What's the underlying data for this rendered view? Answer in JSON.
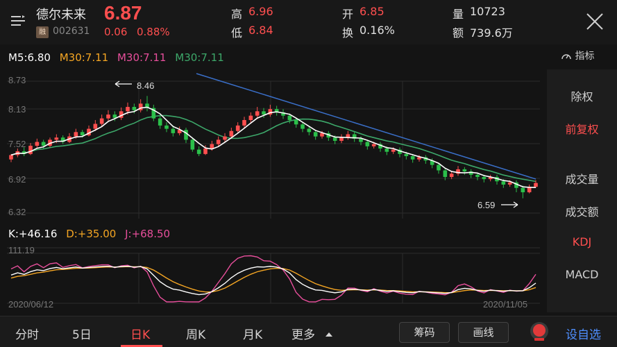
{
  "header": {
    "stock_name": "德尔未来",
    "badge": "融",
    "stock_code": "002631",
    "price": "6.87",
    "change": "0.06",
    "change_pct": "0.88%",
    "high_label": "高",
    "high": "6.96",
    "low_label": "低",
    "low": "6.84",
    "open_label": "开",
    "open": "6.85",
    "turnover_label": "换",
    "turnover": "0.16%",
    "volume_label": "量",
    "volume": "10723",
    "amount_label": "额",
    "amount": "739.6万",
    "menu_icon": "menu-icon",
    "close_icon": "close-icon"
  },
  "ma": {
    "m5": "M5:6.80",
    "m30a": "M30:7.11",
    "m30b": "M30:7.11",
    "m30c": "M30:7.11",
    "indicator_label": "指标",
    "indicator_icon": "gauge-icon"
  },
  "right_panel": {
    "items": [
      "除权",
      "前复权",
      "成交量",
      "成交额",
      "KDJ",
      "MACD"
    ],
    "active": [
      "前复权",
      "KDJ"
    ]
  },
  "kdj": {
    "k": "K:+46.16",
    "d": "D:+35.00",
    "j": "J:+68.50"
  },
  "bottom": {
    "tabs": [
      "分时",
      "5日",
      "日K",
      "周K",
      "月K",
      "更多"
    ],
    "active_tab": "日K",
    "chips_btn": "筹码",
    "draw_btn": "画线",
    "add_fav": "设自选"
  },
  "colors": {
    "up": "#ff4f4f",
    "down": "#2bbf4a",
    "ma5": "#ffffff",
    "ma30_orange": "#f5a623",
    "ma30_pink": "#e84f9c",
    "ma30_green": "#3da86a",
    "trendline": "#3a6fc9"
  },
  "chart_data": [
    {
      "type": "candlestick",
      "y_ticks": [
        "8.73",
        "8.13",
        "7.52",
        "6.92",
        "6.32"
      ],
      "ylim": [
        6.32,
        8.73
      ],
      "high_marker": "8.46",
      "low_marker": "6.59",
      "candles": [
        [
          7.3,
          7.38,
          7.25,
          7.4
        ],
        [
          7.38,
          7.45,
          7.34,
          7.5
        ],
        [
          7.45,
          7.4,
          7.36,
          7.52
        ],
        [
          7.4,
          7.55,
          7.38,
          7.6
        ],
        [
          7.55,
          7.62,
          7.5,
          7.68
        ],
        [
          7.62,
          7.55,
          7.5,
          7.66
        ],
        [
          7.55,
          7.66,
          7.52,
          7.7
        ],
        [
          7.66,
          7.7,
          7.6,
          7.76
        ],
        [
          7.7,
          7.62,
          7.58,
          7.74
        ],
        [
          7.62,
          7.72,
          7.6,
          7.78
        ],
        [
          7.72,
          7.8,
          7.68,
          7.86
        ],
        [
          7.8,
          7.74,
          7.7,
          7.84
        ],
        [
          7.74,
          7.86,
          7.72,
          7.92
        ],
        [
          7.86,
          7.95,
          7.82,
          8.02
        ],
        [
          7.95,
          8.05,
          7.9,
          8.12
        ],
        [
          8.05,
          8.12,
          8.0,
          8.2
        ],
        [
          8.12,
          8.06,
          8.0,
          8.18
        ],
        [
          8.06,
          8.18,
          8.02,
          8.25
        ],
        [
          8.18,
          8.26,
          8.12,
          8.34
        ],
        [
          8.26,
          8.2,
          8.14,
          8.32
        ],
        [
          8.2,
          8.32,
          8.16,
          8.4
        ],
        [
          8.32,
          8.24,
          8.18,
          8.46
        ],
        [
          8.24,
          8.05,
          8.0,
          8.3
        ],
        [
          8.05,
          7.92,
          7.86,
          8.1
        ],
        [
          7.92,
          7.86,
          7.8,
          7.98
        ],
        [
          7.86,
          7.78,
          7.72,
          7.92
        ],
        [
          7.78,
          7.84,
          7.74,
          7.9
        ],
        [
          7.84,
          7.66,
          7.6,
          7.88
        ],
        [
          7.66,
          7.48,
          7.44,
          7.7
        ],
        [
          7.48,
          7.4,
          7.36,
          7.54
        ],
        [
          7.4,
          7.5,
          7.38,
          7.56
        ],
        [
          7.5,
          7.58,
          7.46,
          7.64
        ],
        [
          7.58,
          7.66,
          7.54,
          7.72
        ],
        [
          7.66,
          7.72,
          7.62,
          7.78
        ],
        [
          7.72,
          7.82,
          7.68,
          7.88
        ],
        [
          7.82,
          7.92,
          7.78,
          7.98
        ],
        [
          7.92,
          8.02,
          7.88,
          8.08
        ],
        [
          8.02,
          8.1,
          7.96,
          8.16
        ],
        [
          8.1,
          8.18,
          8.04,
          8.26
        ],
        [
          8.18,
          8.12,
          8.06,
          8.24
        ],
        [
          8.12,
          8.22,
          8.08,
          8.3
        ],
        [
          8.22,
          8.16,
          8.1,
          8.28
        ],
        [
          8.16,
          8.1,
          8.04,
          8.22
        ],
        [
          8.1,
          8.02,
          7.96,
          8.14
        ],
        [
          8.02,
          7.94,
          7.88,
          8.06
        ],
        [
          7.94,
          7.86,
          7.8,
          7.98
        ],
        [
          7.86,
          7.8,
          7.74,
          7.9
        ],
        [
          7.8,
          7.72,
          7.66,
          7.84
        ],
        [
          7.72,
          7.78,
          7.68,
          7.82
        ],
        [
          7.78,
          7.7,
          7.64,
          7.82
        ],
        [
          7.7,
          7.64,
          7.58,
          7.74
        ],
        [
          7.64,
          7.7,
          7.6,
          7.76
        ],
        [
          7.7,
          7.76,
          7.66,
          7.82
        ],
        [
          7.76,
          7.68,
          7.62,
          7.8
        ],
        [
          7.68,
          7.62,
          7.56,
          7.72
        ],
        [
          7.62,
          7.54,
          7.48,
          7.66
        ],
        [
          7.54,
          7.58,
          7.5,
          7.62
        ],
        [
          7.58,
          7.5,
          7.44,
          7.62
        ],
        [
          7.5,
          7.44,
          7.38,
          7.54
        ],
        [
          7.44,
          7.48,
          7.4,
          7.52
        ],
        [
          7.48,
          7.4,
          7.34,
          7.52
        ],
        [
          7.4,
          7.36,
          7.3,
          7.44
        ],
        [
          7.36,
          7.3,
          7.24,
          7.4
        ],
        [
          7.3,
          7.34,
          7.26,
          7.38
        ],
        [
          7.34,
          7.28,
          7.22,
          7.38
        ],
        [
          7.28,
          7.2,
          7.14,
          7.32
        ],
        [
          7.2,
          7.1,
          7.04,
          7.24
        ],
        [
          7.1,
          6.98,
          6.92,
          7.14
        ],
        [
          6.98,
          7.04,
          6.94,
          7.08
        ],
        [
          7.04,
          7.12,
          7.0,
          7.18
        ],
        [
          7.12,
          7.08,
          7.02,
          7.16
        ],
        [
          7.08,
          7.02,
          6.96,
          7.12
        ],
        [
          7.02,
          6.98,
          6.92,
          7.06
        ],
        [
          6.98,
          6.94,
          6.88,
          7.02
        ],
        [
          6.94,
          6.98,
          6.9,
          7.02
        ],
        [
          6.98,
          6.9,
          6.84,
          7.02
        ],
        [
          6.9,
          6.84,
          6.78,
          6.94
        ],
        [
          6.84,
          6.88,
          6.8,
          6.92
        ],
        [
          6.88,
          6.78,
          6.7,
          6.92
        ],
        [
          6.78,
          6.7,
          6.59,
          6.82
        ],
        [
          6.7,
          6.8,
          6.68,
          6.84
        ],
        [
          6.8,
          6.87,
          6.78,
          6.92
        ]
      ]
    },
    {
      "type": "line",
      "name": "KDJ",
      "y_tick": "111.19",
      "x_start": "2020/06/12",
      "x_end": "2020/11/05"
    }
  ]
}
